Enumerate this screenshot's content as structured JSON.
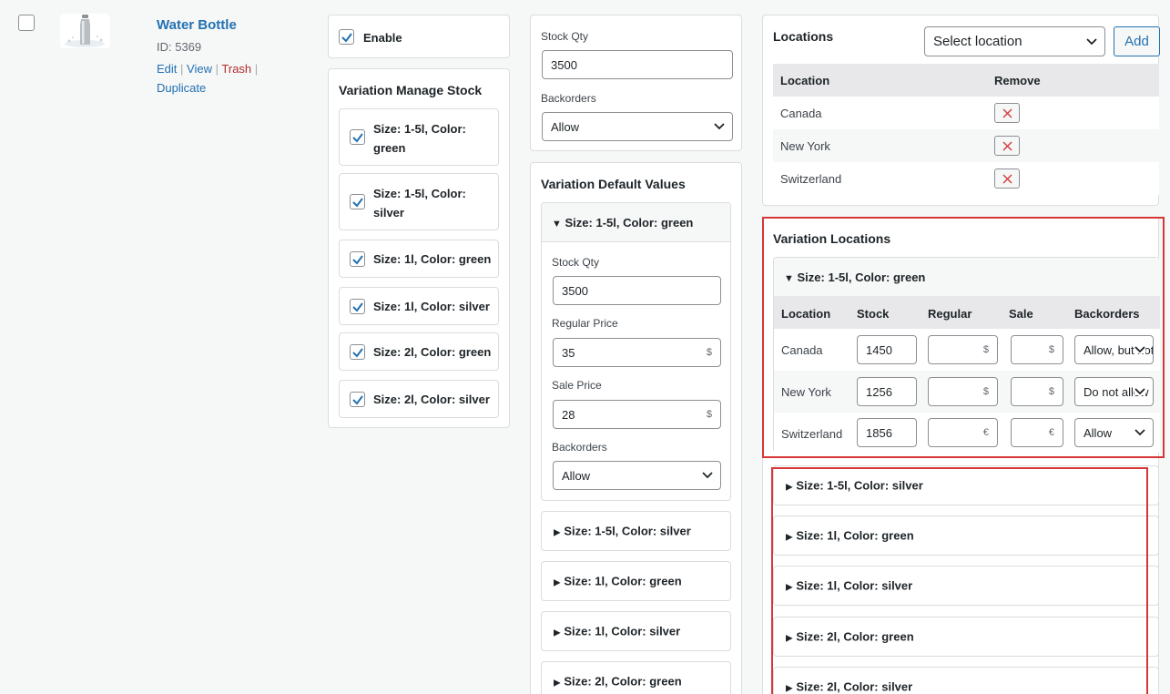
{
  "product": {
    "name": "Water Bottle",
    "id_text": "ID: 5369",
    "actions": {
      "edit": "Edit",
      "view": "View",
      "trash": "Trash",
      "duplicate": "Duplicate",
      "separator": "|"
    }
  },
  "enable": {
    "label": "Enable",
    "checked": true
  },
  "variation_manage_stock": {
    "title": "Variation Manage Stock",
    "items": [
      {
        "label": "Size: 1-5l, Color: green",
        "checked": true
      },
      {
        "label": "Size: 1-5l, Color: silver",
        "checked": true
      },
      {
        "label": "Size: 1l, Color: green",
        "checked": true
      },
      {
        "label": "Size: 1l, Color: silver",
        "checked": true
      },
      {
        "label": "Size: 2l, Color: green",
        "checked": true
      },
      {
        "label": "Size: 2l, Color: silver",
        "checked": true
      }
    ]
  },
  "stock": {
    "qty_label": "Stock Qty",
    "qty_value": "3500",
    "backorders_label": "Backorders",
    "backorders_value": "Allow"
  },
  "variation_defaults": {
    "title": "Variation Default Values",
    "expanded": {
      "title": "Size: 1-5l, Color: green",
      "stock_label": "Stock Qty",
      "stock_value": "3500",
      "regular_label": "Regular Price",
      "regular_value": "35",
      "sale_label": "Sale Price",
      "sale_value": "28",
      "currency": "$",
      "backorders_label": "Backorders",
      "backorders_value": "Allow"
    },
    "collapsed": [
      "Size: 1-5l, Color: silver",
      "Size: 1l, Color: green",
      "Size: 1l, Color: silver",
      "Size: 2l, Color: green"
    ]
  },
  "locations": {
    "title": "Locations",
    "select_placeholder": "Select location",
    "add_label": "Add",
    "columns": [
      "Location",
      "Remove"
    ],
    "rows": [
      "Canada",
      "New York",
      "Switzerland"
    ]
  },
  "variation_locations": {
    "title": "Variation Locations",
    "expanded_title": "Size: 1-5l, Color: green",
    "columns": [
      "Location",
      "Stock",
      "Regular",
      "Sale",
      "Backorders"
    ],
    "rows": [
      {
        "location": "Canada",
        "stock": "1450",
        "currency": "$",
        "backorders": "Allow, but notify"
      },
      {
        "location": "New York",
        "stock": "1256",
        "currency": "$",
        "backorders": "Do not allow"
      },
      {
        "location": "Switzerland",
        "stock": "1856",
        "currency": "€",
        "backorders": "Allow"
      }
    ],
    "collapsed": [
      "Size: 1-5l, Color: silver",
      "Size: 1l, Color: green",
      "Size: 1l, Color: silver",
      "Size: 2l, Color: green",
      "Size: 2l, Color: silver"
    ]
  },
  "colors": {
    "link": "#2271b1",
    "trash": "#b32d2e",
    "highlight": "#d63638",
    "remove_x": "#d63638"
  }
}
